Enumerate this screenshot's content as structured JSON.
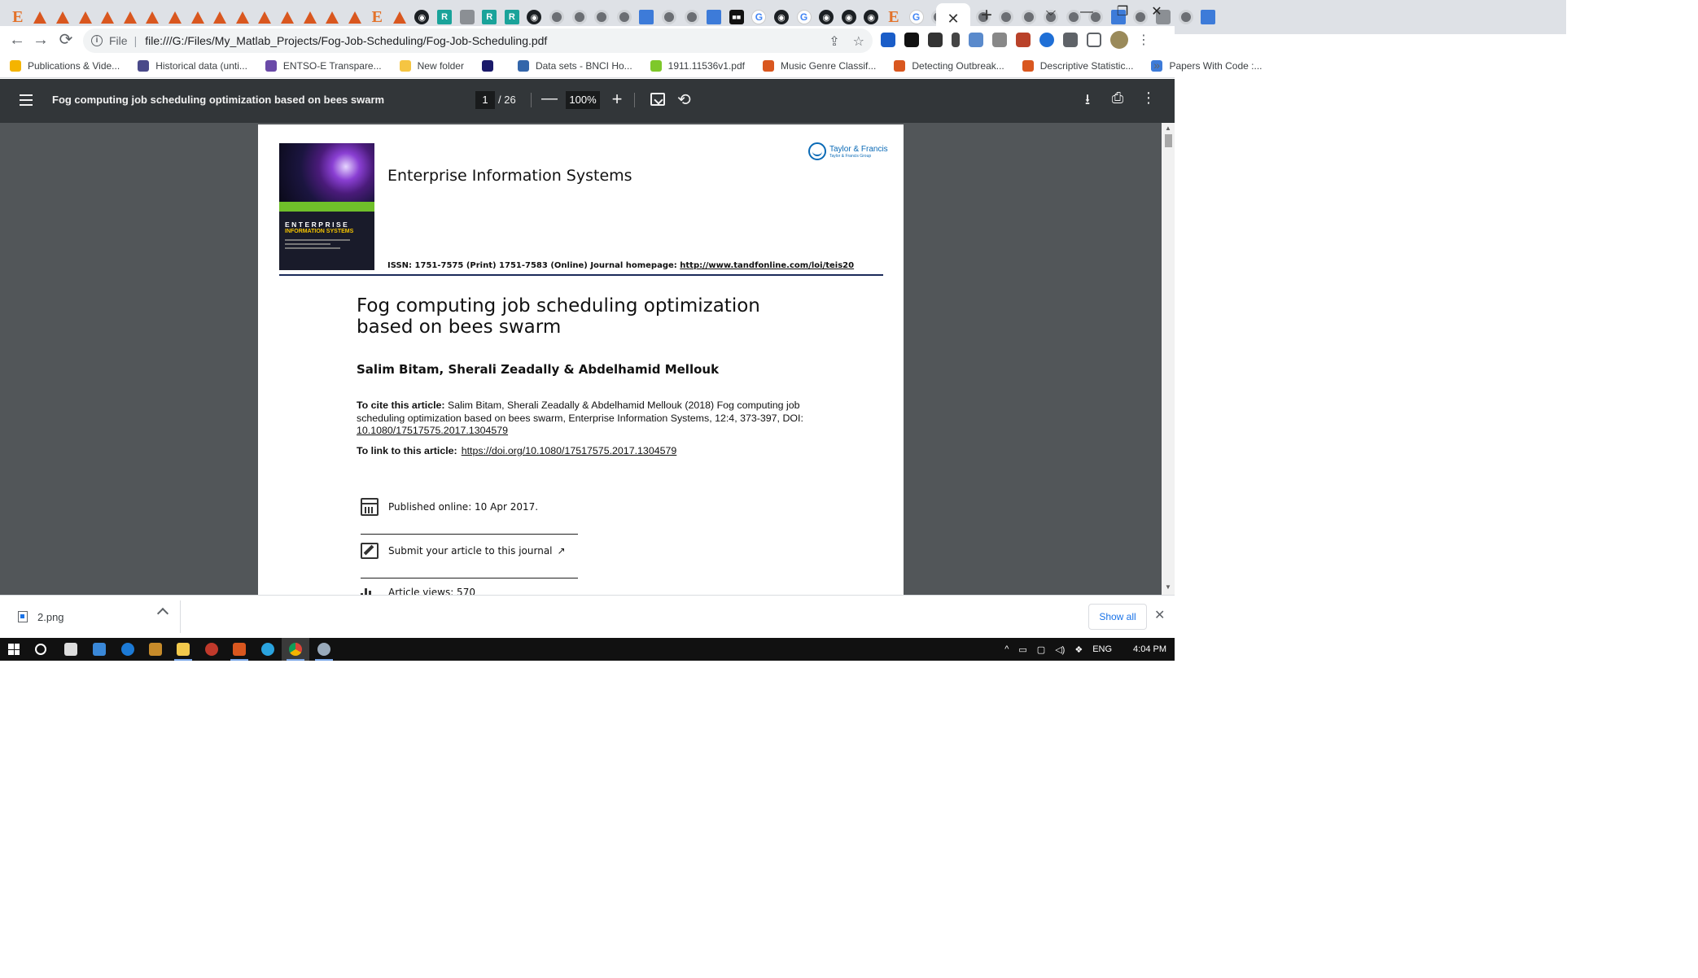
{
  "browser": {
    "tab_favicons": [
      "elsevier",
      "matlab",
      "matlab",
      "matlab",
      "matlab",
      "matlab",
      "matlab",
      "matlab",
      "matlab",
      "matlab",
      "matlab",
      "matlab",
      "matlab",
      "matlab",
      "matlab",
      "matlab",
      "elsevier",
      "matlab",
      "gh",
      "rg",
      "grey",
      "rg",
      "rg",
      "gh",
      "globe",
      "globe",
      "globe",
      "globe",
      "blue",
      "globe",
      "globe",
      "blue",
      "dark",
      "google",
      "gh",
      "google",
      "gh",
      "gh",
      "gh",
      "elsevier",
      "google",
      "globe",
      "google",
      "globe",
      "globe",
      "globe",
      "globe",
      "globe",
      "globe",
      "blue",
      "globe",
      "grey",
      "globe",
      "blue"
    ],
    "active_tab_close": "✕",
    "new_tab": "+",
    "window_controls": [
      "⌵",
      "—",
      "❐",
      "✕"
    ],
    "nav": {
      "back": "←",
      "forward": "→",
      "reload": "⟳"
    },
    "address": {
      "scheme": "File",
      "url": "file:///G:/Files/My_Matlab_Projects/Fog-Job-Scheduling/Fog-Job-Scheduling.pdf"
    },
    "omnibox_icons": [
      "share-icon",
      "star-icon"
    ],
    "bookmarks": [
      {
        "label": "Publications & Vide...",
        "color": "#f4b400"
      },
      {
        "label": "Historical data (unti...",
        "color": "#4a4a8a"
      },
      {
        "label": "ENTSO-E Transpare...",
        "color": "#6a4aa8"
      },
      {
        "label": "New folder",
        "color": "#f5c542"
      },
      {
        "label": "",
        "color": "#1a1a6a"
      },
      {
        "label": "Data sets - BNCI Ho...",
        "color": "#3366aa"
      },
      {
        "label": "1911.11536v1.pdf",
        "color": "#7ec82a"
      },
      {
        "label": "Music Genre Classif...",
        "color": "#d9571f"
      },
      {
        "label": "Detecting Outbreak...",
        "color": "#d9571f"
      },
      {
        "label": "Descriptive Statistic...",
        "color": "#d9571f"
      },
      {
        "label": "Papers With Code :...",
        "color": "#3d7bd9"
      }
    ],
    "bookmarks_more": "»"
  },
  "pdf": {
    "title": "Fog computing job scheduling optimization based on bees swarm",
    "page_current": "1",
    "page_total": "/ 26",
    "zoom": "100%",
    "zoom_out": "—",
    "zoom_in": "+",
    "rotate": "⟲",
    "download": "⭳",
    "print": "⎙",
    "more": "⋮"
  },
  "document": {
    "cover_title": "ENTERPRISE",
    "cover_subtitle": "INFORMATION SYSTEMS",
    "journal_name": "Enterprise Information Systems",
    "publisher_name": "Taylor & Francis",
    "publisher_group": "Taylor & Francis Group",
    "issn_text": "ISSN: 1751-7575 (Print) 1751-7583 (Online) Journal homepage: ",
    "issn_link": "http://www.tandfonline.com/loi/teis20",
    "article_title": "Fog computing job scheduling optimization based on bees swarm",
    "authors": "Salim Bitam, Sherali Zeadally & Abdelhamid Mellouk",
    "cite_label": "To cite this article:",
    "cite_text": " Salim Bitam, Sherali Zeadally & Abdelhamid Mellouk (2018) Fog computing job scheduling optimization based on bees swarm, Enterprise Information Systems, 12:4, 373-397, DOI: ",
    "cite_doi": "10.1080/17517575.2017.1304579",
    "link_label": "To link to this article:",
    "link_url": "https://doi.org/10.1080/17517575.2017.1304579",
    "published": "Published online: 10 Apr 2017.",
    "submit": "Submit your article to this journal",
    "views": "Article views: 570"
  },
  "downloads": {
    "file_name": "2.png",
    "show_all": "Show all",
    "close": "✕"
  },
  "taskbar": {
    "language": "ENG",
    "time": "4:04 PM"
  }
}
